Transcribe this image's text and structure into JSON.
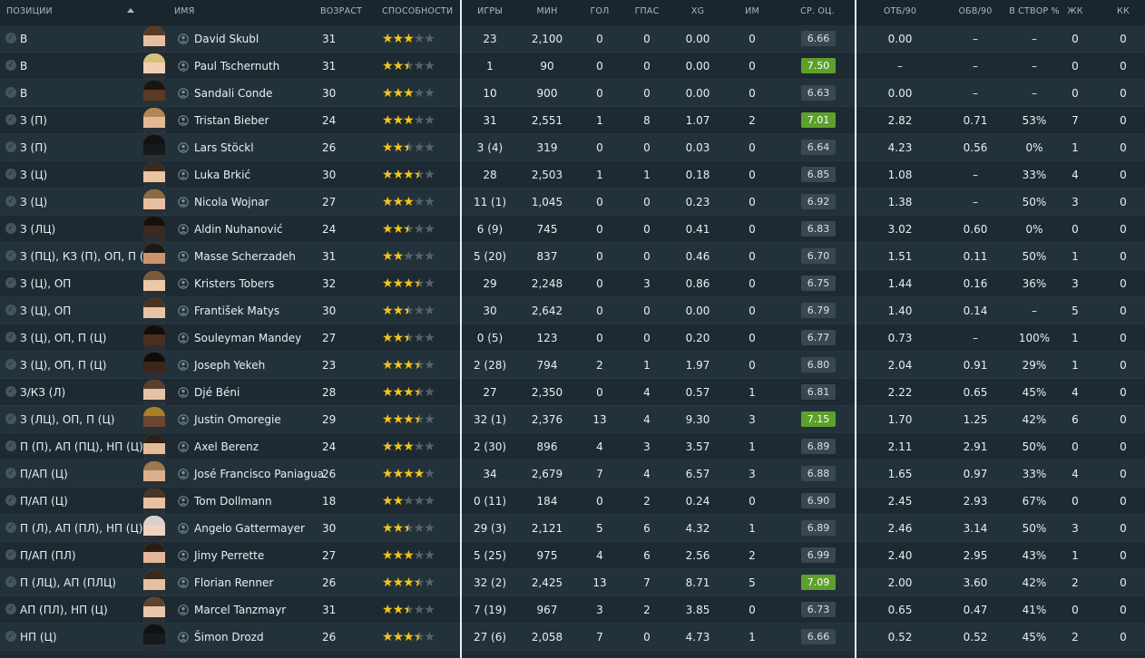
{
  "header": {
    "position": "ПОЗИЦИИ",
    "name": "ИМЯ",
    "age": "ВОЗРАСТ",
    "ability": "СПОСОБНОСТИ",
    "apps": "ИГРЫ",
    "mins": "МИН",
    "goals": "ГОЛ",
    "assists": "ГПАС",
    "xg": "XG",
    "pom": "ИМ",
    "rating": "СР. ОЦ.",
    "tackles90": "ОТБ/90",
    "dribbles90": "ОБВ/90",
    "on_target": "В СТВОР %",
    "yellow": "ЖК",
    "red": "КК"
  },
  "colors": {
    "star_on": "#f5c518",
    "star_off": "#56636c",
    "rating_high": "#5da02c",
    "rating_normal": "#3a4750"
  },
  "players": [
    {
      "pos": "В",
      "name": "David Skubl",
      "age": "31",
      "stars": 3,
      "apps": "23",
      "mins": "2,100",
      "gls": "0",
      "ast": "0",
      "xg": "0.00",
      "pom": "0",
      "rating": "6.66",
      "rating_high": false,
      "tck": "0.00",
      "drb": "–",
      "shot": "–",
      "yel": "0",
      "red": "0",
      "skin": "#e6bfa0",
      "hair": "#5a3b22"
    },
    {
      "pos": "В",
      "name": "Paul Tschernuth",
      "age": "31",
      "stars": 2.5,
      "apps": "1",
      "mins": "90",
      "gls": "0",
      "ast": "0",
      "xg": "0.00",
      "pom": "0",
      "rating": "7.50",
      "rating_high": true,
      "tck": "–",
      "drb": "–",
      "shot": "–",
      "yel": "0",
      "red": "0",
      "skin": "#f0cfb4",
      "hair": "#d8c07a"
    },
    {
      "pos": "В",
      "name": "Sandali Conde",
      "age": "30",
      "stars": 3,
      "apps": "10",
      "mins": "900",
      "gls": "0",
      "ast": "0",
      "xg": "0.00",
      "pom": "0",
      "rating": "6.63",
      "rating_high": false,
      "tck": "0.00",
      "drb": "–",
      "shot": "–",
      "yel": "0",
      "red": "0",
      "skin": "#5a3a26",
      "hair": "#1c1410"
    },
    {
      "pos": "З (П)",
      "name": "Tristan Bieber",
      "age": "24",
      "stars": 3,
      "apps": "31",
      "mins": "2,551",
      "gls": "1",
      "ast": "8",
      "xg": "1.07",
      "pom": "2",
      "rating": "7.01",
      "rating_high": true,
      "tck": "2.82",
      "drb": "0.71",
      "shot": "53%",
      "yel": "7",
      "red": "0",
      "skin": "#e2b896",
      "hair": "#b08850"
    },
    {
      "pos": "З (П)",
      "name": "Lars Stöckl",
      "age": "26",
      "stars": 2.5,
      "apps": "3 (4)",
      "mins": "319",
      "gls": "0",
      "ast": "0",
      "xg": "0.03",
      "pom": "0",
      "rating": "6.64",
      "rating_high": false,
      "tck": "4.23",
      "drb": "0.56",
      "shot": "0%",
      "yel": "1",
      "red": "0",
      "skin": "#151a1e",
      "hair": "#111"
    },
    {
      "pos": "З (Ц)",
      "name": "Luka Brkić",
      "age": "30",
      "stars": 3.5,
      "apps": "28",
      "mins": "2,503",
      "gls": "1",
      "ast": "1",
      "xg": "0.18",
      "pom": "0",
      "rating": "6.85",
      "rating_high": false,
      "tck": "1.08",
      "drb": "–",
      "shot": "33%",
      "yel": "4",
      "red": "0",
      "skin": "#e8c3a4",
      "hair": "#3b2a1c"
    },
    {
      "pos": "З (Ц)",
      "name": "Nicola Wojnar",
      "age": "27",
      "stars": 3,
      "apps": "11 (1)",
      "mins": "1,045",
      "gls": "0",
      "ast": "0",
      "xg": "0.23",
      "pom": "0",
      "rating": "6.92",
      "rating_high": false,
      "tck": "1.38",
      "drb": "–",
      "shot": "50%",
      "yel": "3",
      "red": "0",
      "skin": "#e6c0a2",
      "hair": "#8c6a44"
    },
    {
      "pos": "З (ЛЦ)",
      "name": "Aldin Nuhanović",
      "age": "24",
      "stars": 2.5,
      "apps": "6 (9)",
      "mins": "745",
      "gls": "0",
      "ast": "0",
      "xg": "0.41",
      "pom": "0",
      "rating": "6.83",
      "rating_high": false,
      "tck": "3.02",
      "drb": "0.60",
      "shot": "0%",
      "yel": "0",
      "red": "0",
      "skin": "#3c2a20",
      "hair": "#15100c"
    },
    {
      "pos": "З (ПЦ), КЗ (П), ОП, П (Ц)",
      "name": "Masse Scherzadeh",
      "age": "31",
      "stars": 2,
      "apps": "5 (20)",
      "mins": "837",
      "gls": "0",
      "ast": "0",
      "xg": "0.46",
      "pom": "0",
      "rating": "6.70",
      "rating_high": false,
      "tck": "1.51",
      "drb": "0.11",
      "shot": "50%",
      "yel": "1",
      "red": "0",
      "skin": "#c9956c",
      "hair": "#1e1712"
    },
    {
      "pos": "З (Ц), ОП",
      "name": "Kristers Tobers",
      "age": "32",
      "stars": 3.5,
      "apps": "29",
      "mins": "2,248",
      "gls": "0",
      "ast": "3",
      "xg": "0.86",
      "pom": "0",
      "rating": "6.75",
      "rating_high": false,
      "tck": "1.44",
      "drb": "0.16",
      "shot": "36%",
      "yel": "3",
      "red": "0",
      "skin": "#ecc8aa",
      "hair": "#7a5a38"
    },
    {
      "pos": "З (Ц), ОП",
      "name": "František Matys",
      "age": "30",
      "stars": 2.5,
      "apps": "30",
      "mins": "2,642",
      "gls": "0",
      "ast": "0",
      "xg": "0.00",
      "pom": "0",
      "rating": "6.79",
      "rating_high": false,
      "tck": "1.40",
      "drb": "0.14",
      "shot": "–",
      "yel": "5",
      "red": "0",
      "skin": "#e8c4a6",
      "hair": "#4a3220"
    },
    {
      "pos": "З (Ц), ОП, П (Ц)",
      "name": "Souleyman Mandey",
      "age": "27",
      "stars": 2.5,
      "apps": "0 (5)",
      "mins": "123",
      "gls": "0",
      "ast": "0",
      "xg": "0.20",
      "pom": "0",
      "rating": "6.77",
      "rating_high": false,
      "tck": "0.73",
      "drb": "–",
      "shot": "100%",
      "yel": "1",
      "red": "0",
      "skin": "#4a2f20",
      "hair": "#120d0a"
    },
    {
      "pos": "З (Ц), ОП, П (Ц)",
      "name": "Joseph Yekeh",
      "age": "23",
      "stars": 3.5,
      "apps": "2 (28)",
      "mins": "794",
      "gls": "2",
      "ast": "1",
      "xg": "1.97",
      "pom": "0",
      "rating": "6.80",
      "rating_high": false,
      "tck": "2.04",
      "drb": "0.91",
      "shot": "29%",
      "yel": "1",
      "red": "0",
      "skin": "#3a261a",
      "hair": "#0f0b08"
    },
    {
      "pos": "З/КЗ (Л)",
      "name": "Djé Béni",
      "age": "28",
      "stars": 3.5,
      "apps": "27",
      "mins": "2,350",
      "gls": "0",
      "ast": "4",
      "xg": "0.57",
      "pom": "1",
      "rating": "6.81",
      "rating_high": false,
      "tck": "2.22",
      "drb": "0.65",
      "shot": "45%",
      "yel": "4",
      "red": "0",
      "skin": "#e6c2a4",
      "hair": "#5a3e28"
    },
    {
      "pos": "З (ЛЦ), ОП, П (Ц)",
      "name": "Justin Omoregie",
      "age": "29",
      "stars": 3.5,
      "apps": "32 (1)",
      "mins": "2,376",
      "gls": "13",
      "ast": "4",
      "xg": "9.30",
      "pom": "3",
      "rating": "7.15",
      "rating_high": true,
      "tck": "1.70",
      "drb": "1.25",
      "shot": "42%",
      "yel": "6",
      "red": "0",
      "skin": "#6a4630",
      "hair": "#a8802a"
    },
    {
      "pos": "П (П), АП (ПЦ), НП (Ц)",
      "name": "Axel Berenz",
      "age": "24",
      "stars": 3,
      "apps": "2 (30)",
      "mins": "896",
      "gls": "4",
      "ast": "3",
      "xg": "3.57",
      "pom": "1",
      "rating": "6.89",
      "rating_high": false,
      "tck": "2.11",
      "drb": "2.91",
      "shot": "50%",
      "yel": "0",
      "red": "0",
      "skin": "#e4bc9c",
      "hair": "#2e2118"
    },
    {
      "pos": "П/АП (Ц)",
      "name": "José Francisco Paniagua",
      "age": "26",
      "stars": 4,
      "apps": "34",
      "mins": "2,679",
      "gls": "7",
      "ast": "4",
      "xg": "6.57",
      "pom": "3",
      "rating": "6.88",
      "rating_high": false,
      "tck": "1.65",
      "drb": "0.97",
      "shot": "33%",
      "yel": "4",
      "red": "0",
      "skin": "#dcb08c",
      "hair": "#9a7a4e"
    },
    {
      "pos": "П/АП (Ц)",
      "name": "Tom Dollmann",
      "age": "18",
      "stars": 2,
      "apps": "0 (11)",
      "mins": "184",
      "gls": "0",
      "ast": "2",
      "xg": "0.24",
      "pom": "0",
      "rating": "6.90",
      "rating_high": false,
      "tck": "2.45",
      "drb": "2.93",
      "shot": "67%",
      "yel": "0",
      "red": "0",
      "skin": "#e6c2a2",
      "hair": "#4a3424"
    },
    {
      "pos": "П (Л), АП (ПЛ), НП (Ц)",
      "name": "Angelo Gattermayer",
      "age": "30",
      "stars": 2.5,
      "apps": "29 (3)",
      "mins": "2,121",
      "gls": "5",
      "ast": "6",
      "xg": "4.32",
      "pom": "1",
      "rating": "6.89",
      "rating_high": false,
      "tck": "2.46",
      "drb": "3.14",
      "shot": "50%",
      "yel": "3",
      "red": "0",
      "skin": "#f0d2c0",
      "hair": "#d8d0cc"
    },
    {
      "pos": "П/АП (ПЛ)",
      "name": "Jimy Perrette",
      "age": "27",
      "stars": 3,
      "apps": "5 (25)",
      "mins": "975",
      "gls": "4",
      "ast": "6",
      "xg": "2.56",
      "pom": "2",
      "rating": "6.99",
      "rating_high": false,
      "tck": "2.40",
      "drb": "2.95",
      "shot": "43%",
      "yel": "1",
      "red": "0",
      "skin": "#e2b898",
      "hair": "#2a1c12"
    },
    {
      "pos": "П (ЛЦ), АП (ПЛЦ)",
      "name": "Florian Renner",
      "age": "26",
      "stars": 3.5,
      "apps": "32 (2)",
      "mins": "2,425",
      "gls": "13",
      "ast": "7",
      "xg": "8.71",
      "pom": "5",
      "rating": "7.09",
      "rating_high": true,
      "tck": "2.00",
      "drb": "3.60",
      "shot": "42%",
      "yel": "2",
      "red": "0",
      "skin": "#e6c0a0",
      "hair": "#3a2a1c"
    },
    {
      "pos": "АП (ПЛ), НП (Ц)",
      "name": "Marcel Tanzmayr",
      "age": "31",
      "stars": 2.5,
      "apps": "7 (19)",
      "mins": "967",
      "gls": "3",
      "ast": "2",
      "xg": "3.85",
      "pom": "0",
      "rating": "6.73",
      "rating_high": false,
      "tck": "0.65",
      "drb": "0.47",
      "shot": "41%",
      "yel": "0",
      "red": "0",
      "skin": "#e8c6aa",
      "hair": "#5c4430"
    },
    {
      "pos": "НП (Ц)",
      "name": "Šimon Drozd",
      "age": "26",
      "stars": 3.5,
      "apps": "27 (6)",
      "mins": "2,058",
      "gls": "7",
      "ast": "0",
      "xg": "4.73",
      "pom": "1",
      "rating": "6.66",
      "rating_high": false,
      "tck": "0.52",
      "drb": "0.52",
      "shot": "45%",
      "yel": "2",
      "red": "0",
      "skin": "#151a1e",
      "hair": "#111"
    }
  ]
}
